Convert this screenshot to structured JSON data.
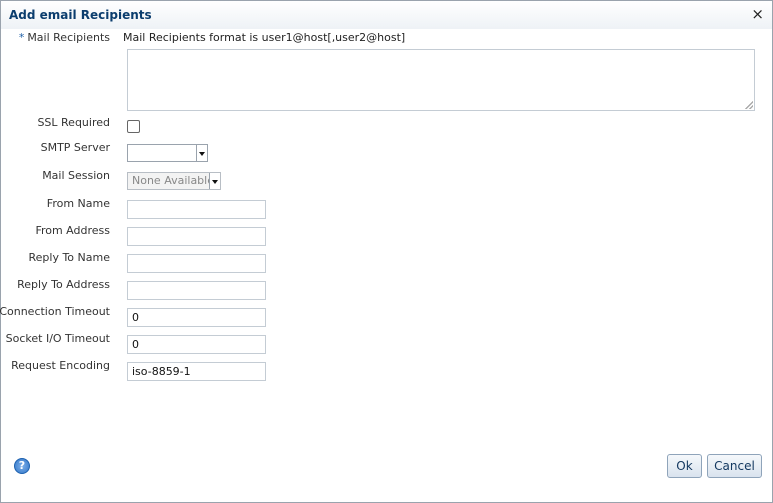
{
  "dialog": {
    "title": "Add email Recipients",
    "close_glyph": "×"
  },
  "form": {
    "mail_recipients": {
      "required_marker": "*",
      "label": "Mail Recipients",
      "hint": "Mail Recipients format is user1@host[,user2@host]",
      "value": ""
    },
    "ssl_required": {
      "label": "SSL Required",
      "checked": false
    },
    "smtp_server": {
      "label": "SMTP Server",
      "value": ""
    },
    "mail_session": {
      "label": "Mail Session",
      "value": "None Available",
      "disabled": true
    },
    "from_name": {
      "label": "From Name",
      "value": ""
    },
    "from_address": {
      "label": "From Address",
      "value": ""
    },
    "reply_to_name": {
      "label": "Reply To Name",
      "value": ""
    },
    "reply_to_address": {
      "label": "Reply To Address",
      "value": ""
    },
    "connection_timeout": {
      "label": "Connection Timeout",
      "value": "0"
    },
    "socket_io_timeout": {
      "label": "Socket I/O Timeout",
      "value": "0"
    },
    "request_encoding": {
      "label": "Request Encoding",
      "value": "iso-8859-1"
    }
  },
  "footer": {
    "help_glyph": "?",
    "ok_label": "Ok",
    "cancel_label": "Cancel"
  }
}
